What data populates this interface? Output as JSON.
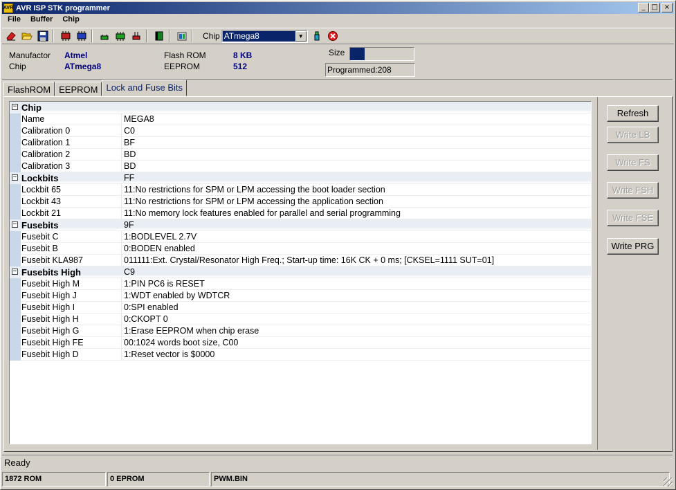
{
  "window": {
    "title": "AVR ISP STK programmer"
  },
  "menu": [
    "File",
    "Buffer",
    "Chip"
  ],
  "toolbar": {
    "chip_label": "Chip",
    "chip_value": "ATmega8",
    "icons": [
      "eraser-icon",
      "open-folder-icon",
      "save-disk-icon",
      "read-chip-icon",
      "write-chip-icon",
      "verify-icon",
      "read-buffer-icon",
      "erase-chip-icon",
      "chip-icon",
      "device-icon",
      "programmer-icon",
      "stop-icon"
    ]
  },
  "info": {
    "manufactor_label": "Manufactor",
    "manufactor_value": "Atmel",
    "chip_label": "Chip",
    "chip_value": "ATmega8",
    "flash_label": "Flash ROM",
    "flash_value": "8 KB",
    "eeprom_label": "EEPROM",
    "eeprom_value": "512",
    "size_label": "Size",
    "programmed": "Programmed:208",
    "size_fill_fraction": 0.23
  },
  "tabs": [
    "FlashROM",
    "EEPROM",
    "Lock and Fuse Bits"
  ],
  "grid": {
    "rows": [
      {
        "type": "group",
        "name": "Chip",
        "value": ""
      },
      {
        "type": "item",
        "name": "Name",
        "value": "MEGA8"
      },
      {
        "type": "item",
        "name": "Calibration 0",
        "value": "C0"
      },
      {
        "type": "item",
        "name": "Calibration 1",
        "value": "BF"
      },
      {
        "type": "item",
        "name": "Calibration 2",
        "value": "BD"
      },
      {
        "type": "item",
        "name": "Calibration 3",
        "value": "BD"
      },
      {
        "type": "group",
        "name": "Lockbits",
        "value": "FF"
      },
      {
        "type": "item",
        "name": "Lockbit 65",
        "value": "11:No restrictions for SPM or LPM accessing the boot loader section"
      },
      {
        "type": "item",
        "name": "Lockbit 43",
        "value": "11:No restrictions for SPM or LPM accessing the application section"
      },
      {
        "type": "item",
        "name": "Lockbit 21",
        "value": "11:No memory lock features enabled for parallel and serial programming"
      },
      {
        "type": "group",
        "name": "Fusebits",
        "value": "9F"
      },
      {
        "type": "item",
        "name": "Fusebit C",
        "value": "1:BODLEVEL 2.7V"
      },
      {
        "type": "item",
        "name": "Fusebit B",
        "value": "0:BODEN enabled"
      },
      {
        "type": "item",
        "name": "Fusebit KLA987",
        "value": "011111:Ext. Crystal/Resonator High Freq.; Start-up time: 16K CK + 0 ms; [CKSEL=1111 SUT=01]"
      },
      {
        "type": "group",
        "name": "Fusebits High",
        "value": "C9"
      },
      {
        "type": "item",
        "name": "Fusebit High M",
        "value": "1:PIN PC6 is RESET"
      },
      {
        "type": "item",
        "name": "Fusebit High J",
        "value": "1:WDT enabled by WDTCR"
      },
      {
        "type": "item",
        "name": "Fusebit High I",
        "value": "0:SPI enabled"
      },
      {
        "type": "item",
        "name": "Fusebit High H",
        "value": "0:CKOPT 0"
      },
      {
        "type": "item",
        "name": "Fusebit High G",
        "value": "1:Erase EEPROM when chip erase"
      },
      {
        "type": "item",
        "name": "Fusebit High FE",
        "value": "00:1024 words boot size, C00"
      },
      {
        "type": "item",
        "name": "Fusebit High D",
        "value": "1:Reset vector is $0000"
      }
    ]
  },
  "buttons": {
    "refresh": "Refresh",
    "write_lb": "Write LB",
    "write_fs": "Write FS",
    "write_fsh": "Write FSH",
    "write_fse": "Write FSE",
    "write_prg": "Write PRG"
  },
  "status": {
    "ready": "Ready",
    "rom": "1872 ROM",
    "eprom": "0 EPROM",
    "file": "PWM.BIN"
  }
}
